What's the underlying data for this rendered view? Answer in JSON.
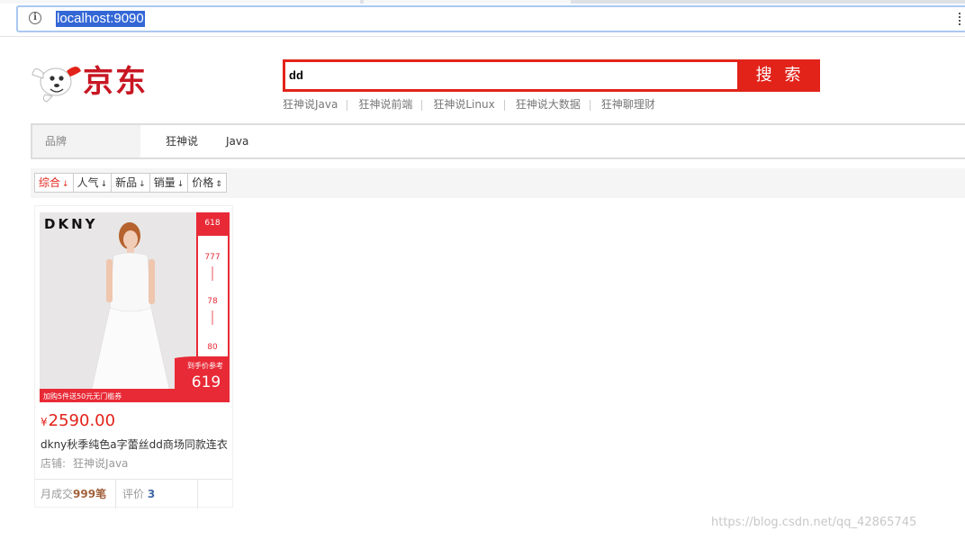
{
  "browser": {
    "url": "localhost:9090"
  },
  "header": {
    "logo_text": "京东",
    "search": {
      "value": "dd",
      "button_label": "搜 索"
    },
    "hotwords": [
      "狂神说Java",
      "狂神说前端",
      "狂神说Linux",
      "狂神说大数据",
      "狂神聊理财"
    ]
  },
  "brand_filter": {
    "label": "品牌",
    "items": [
      "狂神说",
      "Java"
    ]
  },
  "sort_bar": {
    "options": [
      {
        "label": "综合",
        "arrow": "↓",
        "active": true
      },
      {
        "label": "人气",
        "arrow": "↓",
        "active": false
      },
      {
        "label": "新品",
        "arrow": "↓",
        "active": false
      },
      {
        "label": "销量",
        "arrow": "↓",
        "active": false
      },
      {
        "label": "价格",
        "arrow": "⇕",
        "active": false
      }
    ]
  },
  "product": {
    "image_brand": "DKNY",
    "image_badges": {
      "top_label": "618",
      "steps": [
        "777",
        "78",
        "80"
      ],
      "ref_label": "到手价参考",
      "ref_price": "619",
      "promo": "加购5件送50元无门槛券"
    },
    "currency": "¥",
    "price": "2590.00",
    "title": "dkny秋季纯色a字蕾丝dd商场同款连衣",
    "shop_label": "店铺:",
    "shop_name": "狂神说Java",
    "sales_prefix": "月成交",
    "sales_count": "999笔",
    "reviews_prefix": "评价",
    "reviews_count": "3"
  },
  "watermark": "https://blog.csdn.net/qq_42865745",
  "colors": {
    "brand_red": "#e2231a",
    "url_highlight": "#3367d6"
  }
}
